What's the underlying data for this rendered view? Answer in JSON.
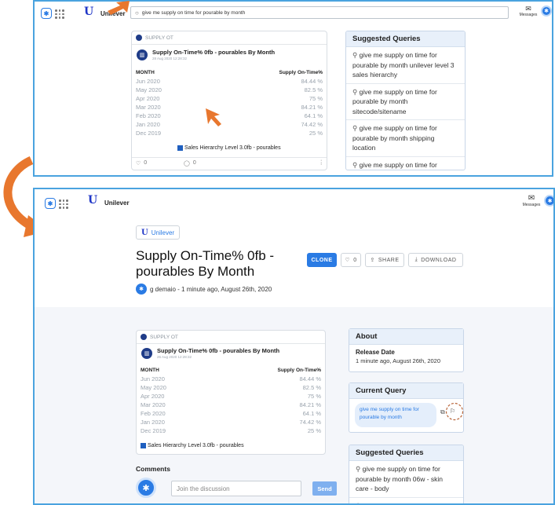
{
  "top": {
    "app_name": "Unilever",
    "search_value": "give me supply on time for pourable by month",
    "messages_label": "Messages",
    "card": {
      "source": "SUPPLY OT",
      "title": "Supply On-Time% 0fb - pourables By Month",
      "date": "28 Aug 2020 12:28:32",
      "col_month": "MONTH",
      "col_value": "Supply On-Time%",
      "rows": [
        {
          "month": "Jun 2020",
          "value": "84.44 %"
        },
        {
          "month": "May 2020",
          "value": "82.5 %"
        },
        {
          "month": "Apr 2020",
          "value": "75 %"
        },
        {
          "month": "Mar 2020",
          "value": "84.21 %"
        },
        {
          "month": "Feb 2020",
          "value": "64.1 %"
        },
        {
          "month": "Jan 2020",
          "value": "74.42 %"
        },
        {
          "month": "Dec 2019",
          "value": "25 %"
        }
      ],
      "footer": "Sales Hierarchy Level 3.0fb - pourables",
      "likes": "0",
      "comments": "0"
    },
    "suggested": {
      "title": "Suggested Queries",
      "items": [
        "give me supply on time for pourable by month unilever level 3 sales hierarchy",
        "give me supply on time for pourable by month sitecode/sitename",
        "give me supply on time for pourable by month shipping location",
        "give me supply on time for pourable by month reason alt desc"
      ]
    }
  },
  "bottom": {
    "app_name": "Unilever",
    "messages_label": "Messages",
    "tag": "Unilever",
    "title_line1": "Supply On-Time% 0fb -",
    "title_line2": "pourables By Month",
    "author": "g demaio - 1 minute ago, August 26th, 2020",
    "clone_label": "CLONE",
    "like_count": "0",
    "share_label": "SHARE",
    "download_label": "DOWNLOAD",
    "card": {
      "source": "SUPPLY OT",
      "title": "Supply On-Time% 0fb - pourables By Month",
      "date": "26 Aug 2020 12:28:32",
      "col_month": "MONTH",
      "col_value": "Supply On-Time%",
      "rows": [
        {
          "month": "Jun 2020",
          "value": "84.44 %"
        },
        {
          "month": "May 2020",
          "value": "82.5 %"
        },
        {
          "month": "Apr 2020",
          "value": "75 %"
        },
        {
          "month": "Mar 2020",
          "value": "84.21 %"
        },
        {
          "month": "Feb 2020",
          "value": "64.1 %"
        },
        {
          "month": "Jan 2020",
          "value": "74.42 %"
        },
        {
          "month": "Dec 2019",
          "value": "25 %"
        }
      ],
      "footer": "Sales Hierarchy Level 3.0fb - pourables"
    },
    "comments_title": "Comments",
    "comment_placeholder": "Join the discussion",
    "send_label": "Send",
    "about": {
      "title": "About",
      "release_label": "Release Date",
      "release_value": "1 minute ago, August 26th, 2020"
    },
    "current_query": {
      "title": "Current Query",
      "text": "give me supply on time for pourable by month"
    },
    "suggested": {
      "title": "Suggested Queries",
      "items": [
        "give me supply on time for pourable by month 06w - skin care - body",
        "give me supply on time for"
      ]
    }
  },
  "colors": {
    "frame_border": "#4aa3df",
    "accent_blue": "#2a7be4",
    "arrow_orange": "#e8772e",
    "bookmark_circle": "#b8653a"
  }
}
